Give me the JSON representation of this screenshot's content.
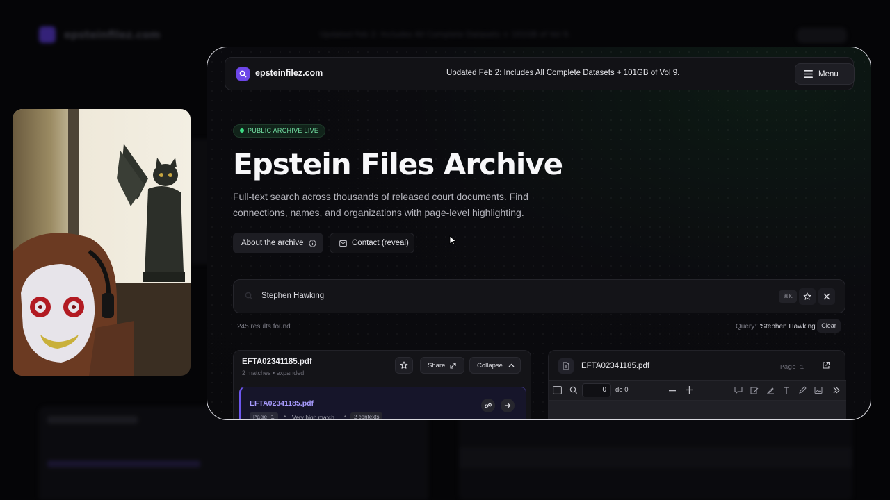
{
  "site": {
    "name": "epsteinfilez.com"
  },
  "topbar": {
    "banner": "Updated Feb 2: Includes All Complete Datasets + 101GB of Vol 9.",
    "menu_label": "Menu"
  },
  "hero": {
    "badge": "PUBLIC ARCHIVE LIVE",
    "title": "Epstein Files Archive",
    "description": "Full-text search across thousands of released court documents. Find connections, names, and organizations with page-level highlighting.",
    "about_label": "About the archive",
    "contact_label": "Contact (reveal)"
  },
  "search": {
    "value": "Stephen Hawking",
    "shortcut": "⌘K"
  },
  "results": {
    "count_text": "245 results found",
    "query_label": "Query:",
    "query_value": "\"Stephen Hawking\"",
    "clear_label": "Clear"
  },
  "result_card": {
    "filename": "EFTA02341185.pdf",
    "subtitle": "2 matches • expanded",
    "share_label": "Share",
    "collapse_label": "Collapse",
    "match": {
      "filename": "EFTA02341185.pdf",
      "page": "Page 1",
      "relevance": "Very high match",
      "contexts": "2 contexts"
    }
  },
  "viewer": {
    "filename": "EFTA02341185.pdf",
    "page_label": "Page 1",
    "page_input": "0",
    "page_of": "de 0"
  },
  "colors": {
    "accent": "#6d46e8",
    "live_green": "#3ddc84",
    "match_purple": "#a99cff"
  }
}
